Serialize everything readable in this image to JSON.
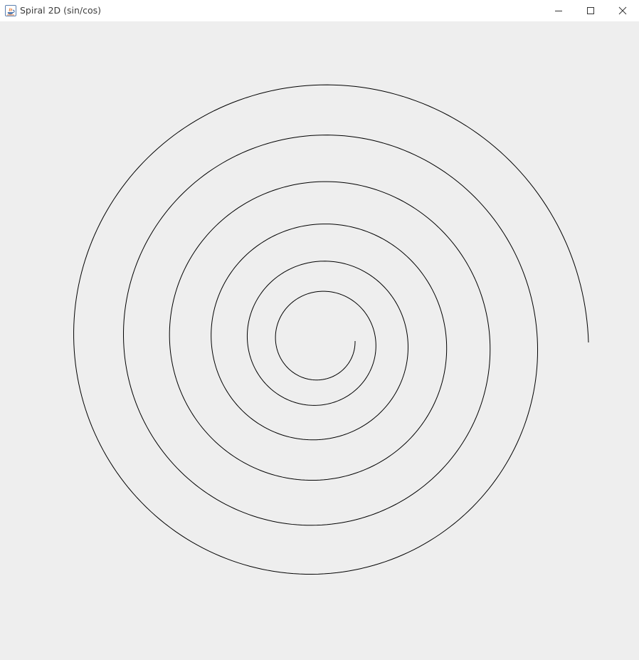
{
  "window": {
    "title": "Spiral 2D (sin/cos)",
    "icon": "java-icon",
    "controls": [
      "minimize-icon",
      "maximize-icon",
      "close-icon"
    ]
  },
  "canvas": {
    "background": "#eeeeee",
    "stroke_color": "#000000"
  }
}
